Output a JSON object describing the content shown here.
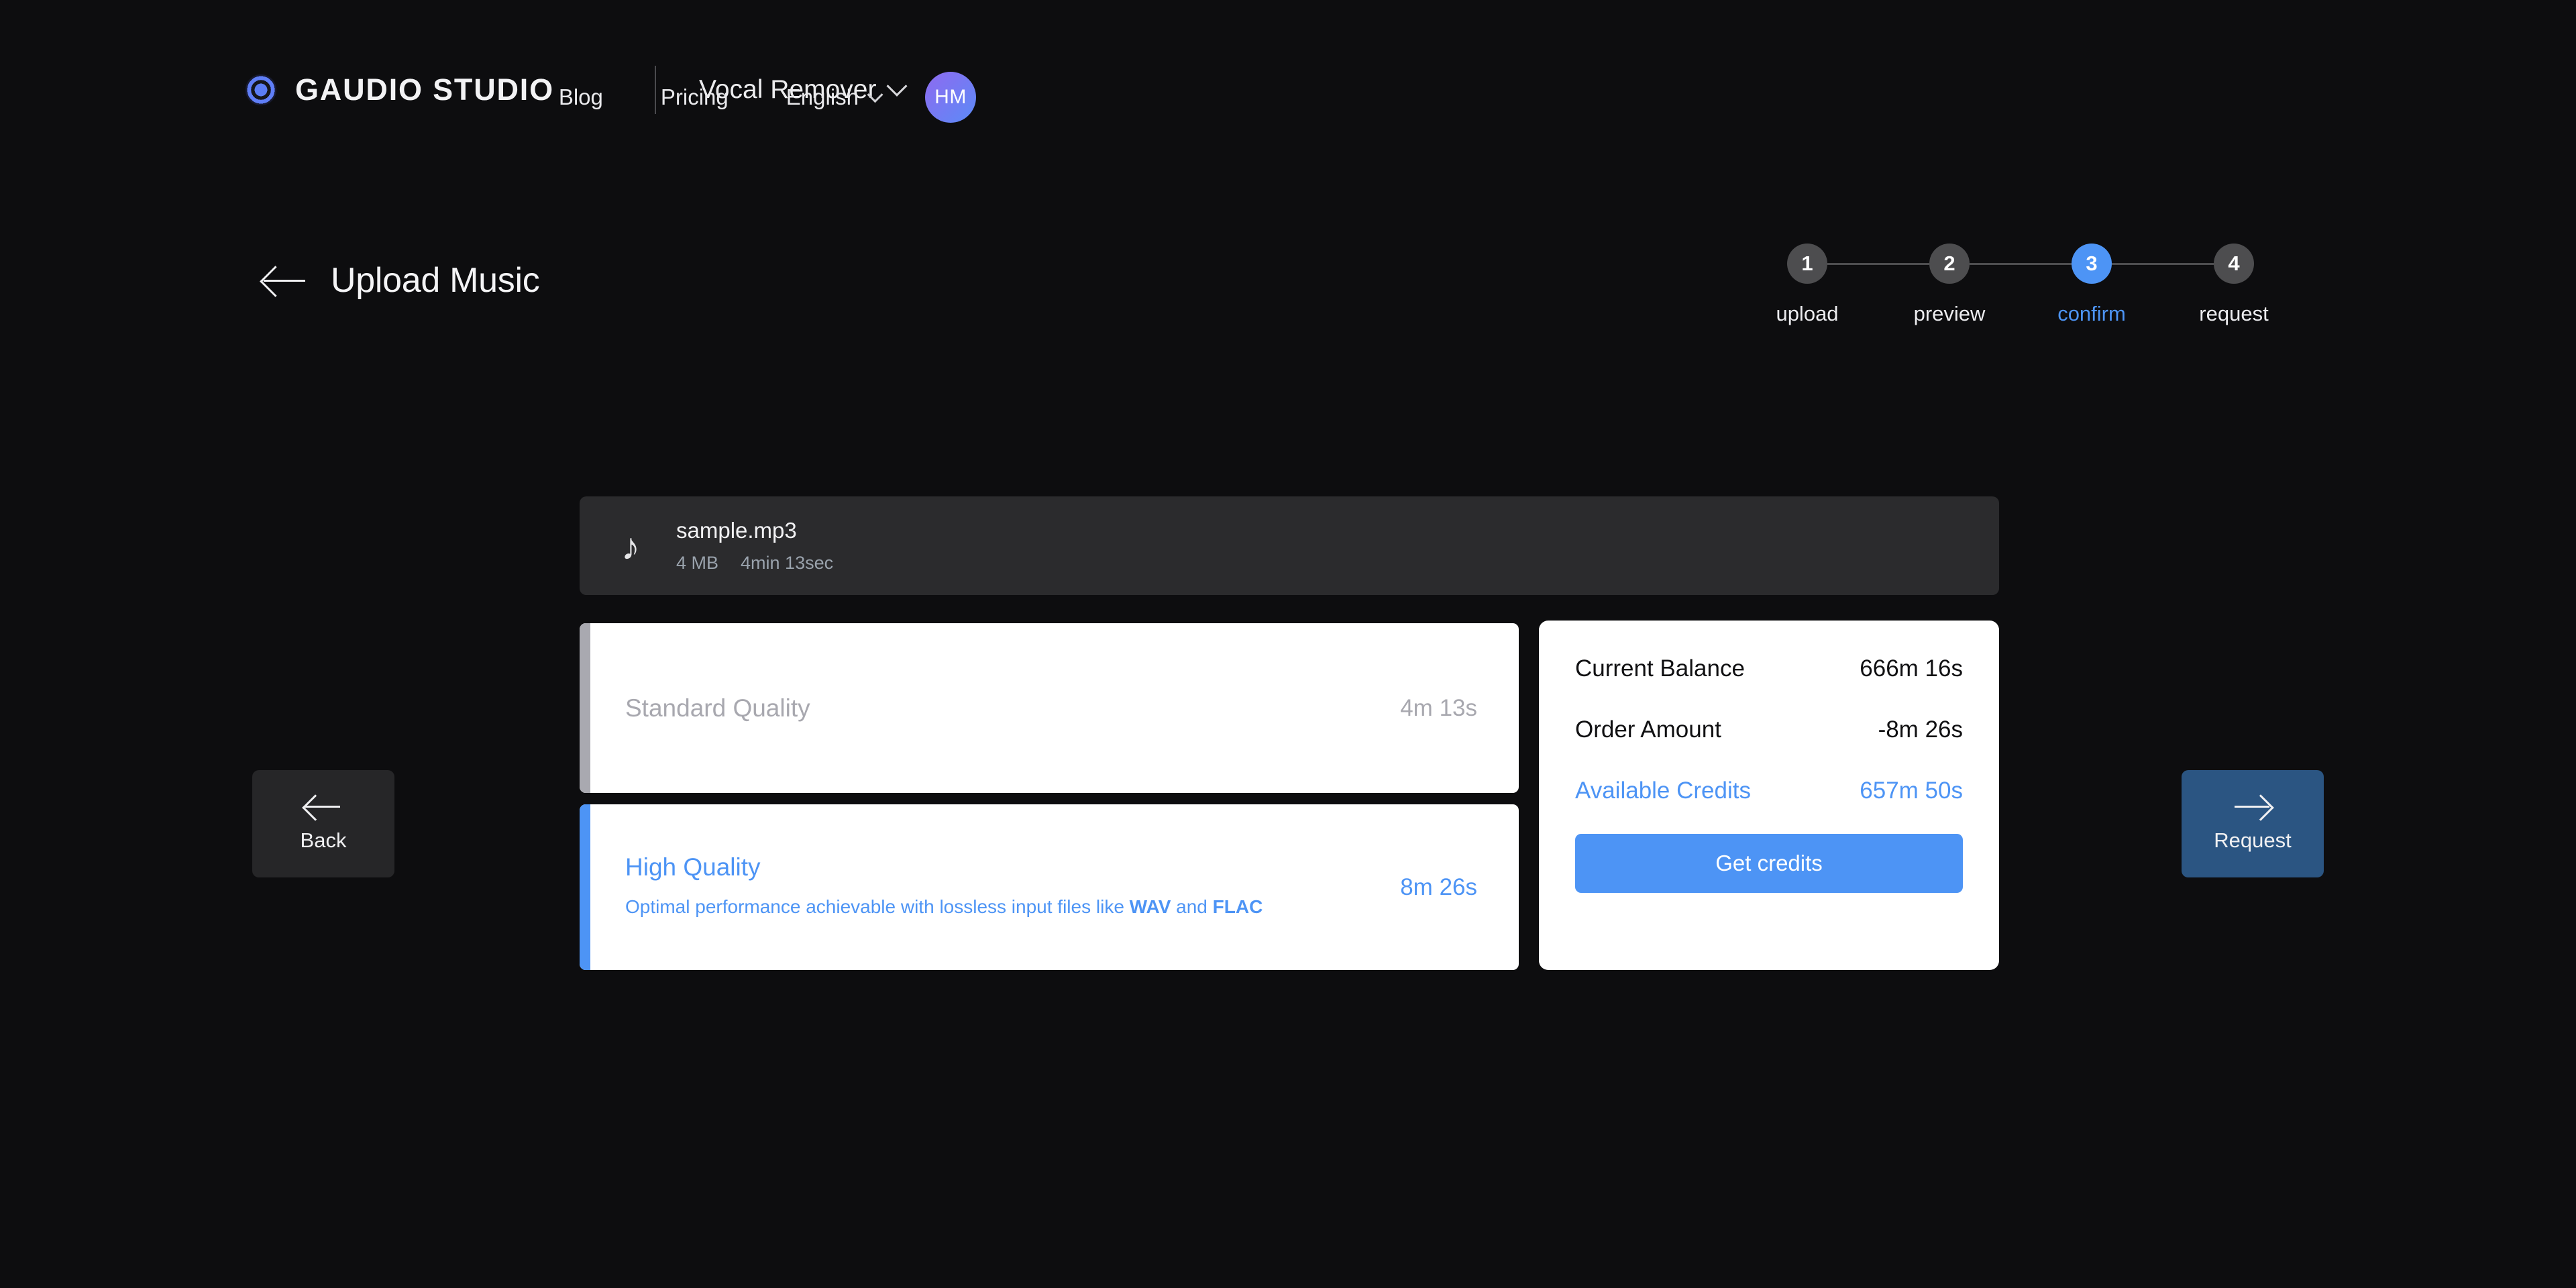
{
  "header": {
    "brand": "GAUDIO STUDIO",
    "logo_icon": "gaudio-ring-logo-icon",
    "product": {
      "label": "Vocal Remover",
      "chevron_icon": "chevron-down-icon"
    },
    "nav": [
      {
        "label": "Blog"
      },
      {
        "label": "Pricing"
      }
    ],
    "language": {
      "label": "English",
      "chevron_icon": "chevron-down-icon"
    },
    "avatar": {
      "initials": "HM",
      "gradient_from": "#8e6bf0",
      "gradient_to": "#5b8bf7"
    }
  },
  "page": {
    "back_icon": "arrow-left-icon",
    "title": "Upload Music"
  },
  "stepper": {
    "steps": [
      {
        "number": "1",
        "caption": "upload",
        "active": false
      },
      {
        "number": "2",
        "caption": "preview",
        "active": false
      },
      {
        "number": "3",
        "caption": "confirm",
        "active": true
      },
      {
        "number": "4",
        "caption": "request",
        "active": false
      }
    ],
    "active_color": "#4d94f5",
    "inactive_color": "#4d4d4f"
  },
  "file": {
    "icon": "music-note-icon",
    "name": "sample.mp3",
    "size": "4 MB",
    "duration": "4min 13sec"
  },
  "quality_options": [
    {
      "id": "standard",
      "title": "Standard Quality",
      "description": "",
      "duration": "4m 13s",
      "selected": false,
      "accent_color": "#a9a9b0"
    },
    {
      "id": "high",
      "title": "High Quality",
      "description_prefix": "Optimal performance achievable with lossless input files like ",
      "description_strong_1": "WAV",
      "description_mid": " and ",
      "description_strong_2": "FLAC",
      "duration": "8m 26s",
      "selected": true,
      "accent_color": "#4d94f5"
    }
  ],
  "balance": {
    "rows": [
      {
        "label": "Current Balance",
        "value": "666m 16s",
        "highlight": false
      },
      {
        "label": "Order Amount",
        "value": "-8m 26s",
        "highlight": false
      },
      {
        "label": "Available Credits",
        "value": "657m 50s",
        "highlight": true
      }
    ],
    "cta_label": "Get credits",
    "cta_color": "#4d94f5"
  },
  "actions": {
    "back": {
      "label": "Back",
      "icon": "arrow-left-icon"
    },
    "request": {
      "label": "Request",
      "icon": "arrow-right-icon",
      "color": "#2b5582"
    }
  }
}
